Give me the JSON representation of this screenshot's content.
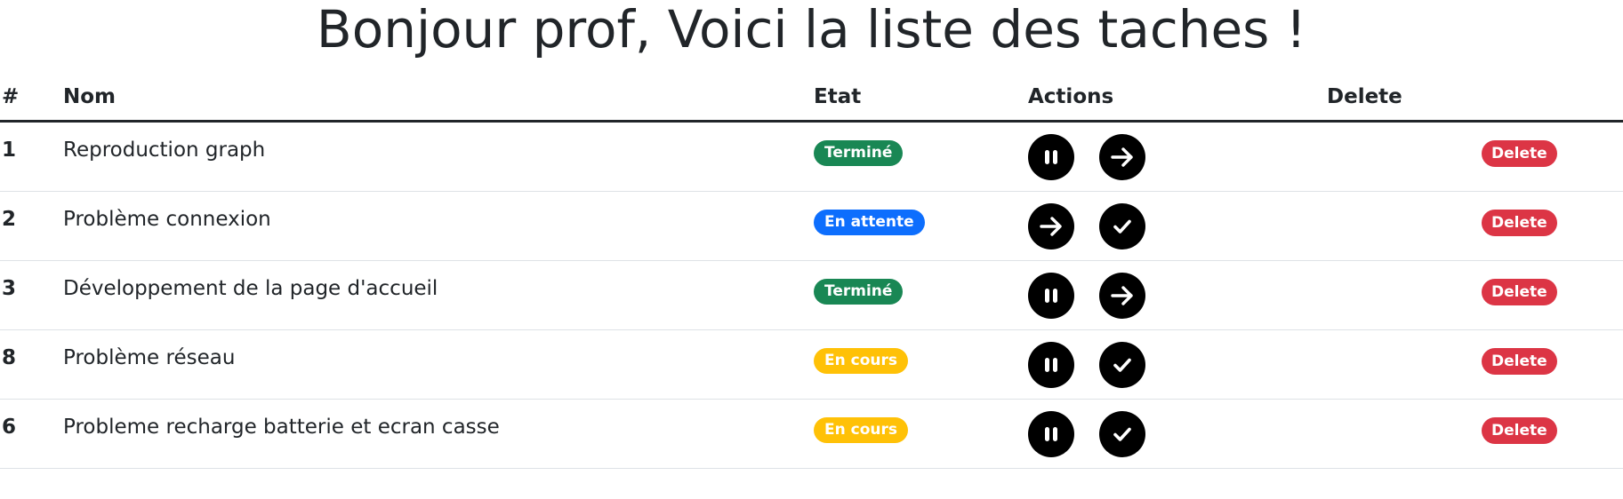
{
  "title": "Bonjour prof, Voici la liste des taches !",
  "table": {
    "headers": {
      "num": "#",
      "name": "Nom",
      "state": "Etat",
      "actions": "Actions",
      "delete": "Delete"
    },
    "rows": [
      {
        "num": "1",
        "name": "Reproduction graph",
        "state": "Terminé",
        "state_color": "#198754",
        "actions": [
          "pause-icon",
          "arrow-right-icon"
        ],
        "delete_label": "Delete"
      },
      {
        "num": "2",
        "name": "Problème connexion",
        "state": "En attente",
        "state_color": "#0d6efd",
        "actions": [
          "arrow-right-icon",
          "check-icon"
        ],
        "delete_label": "Delete"
      },
      {
        "num": "3",
        "name": "Développement de la page d'accueil",
        "state": "Terminé",
        "state_color": "#198754",
        "actions": [
          "pause-icon",
          "arrow-right-icon"
        ],
        "delete_label": "Delete"
      },
      {
        "num": "8",
        "name": "Problème réseau",
        "state": "En cours",
        "state_color": "#ffc107",
        "actions": [
          "pause-icon",
          "check-icon"
        ],
        "delete_label": "Delete"
      },
      {
        "num": "6",
        "name": "Probleme recharge batterie et ecran casse",
        "state": "En cours",
        "state_color": "#ffc107",
        "actions": [
          "pause-icon",
          "check-icon"
        ],
        "delete_label": "Delete"
      }
    ]
  },
  "colors": {
    "text": "#212529",
    "success": "#198754",
    "primary": "#0d6efd",
    "warning": "#ffc107",
    "danger": "#dc3545",
    "icon_bg": "#000000"
  }
}
